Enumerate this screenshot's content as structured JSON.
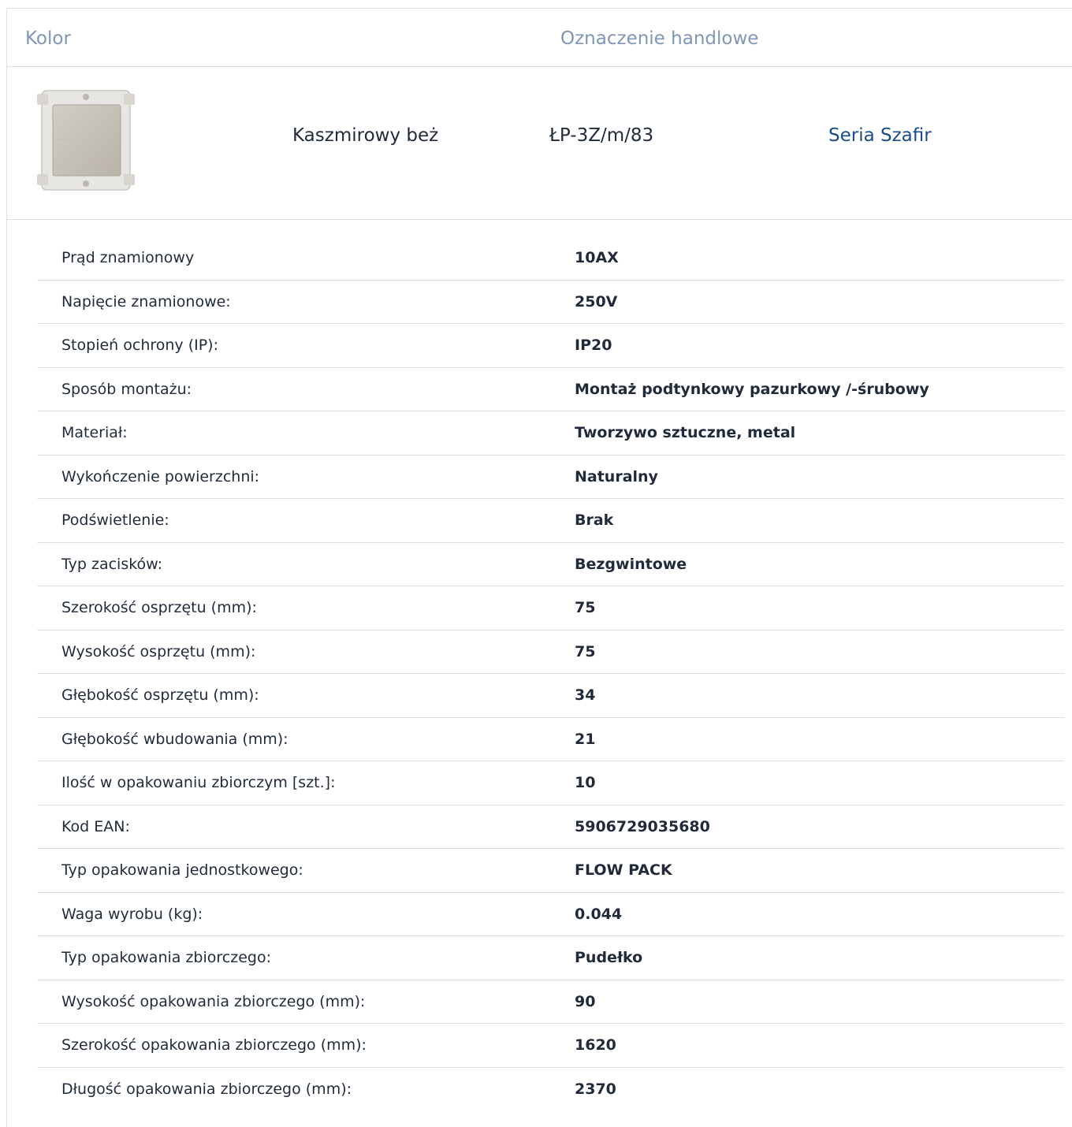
{
  "header": {
    "color_label": "Kolor",
    "designation_label": "Oznaczenie handlowe"
  },
  "product": {
    "image_icon": "light-switch-icon",
    "color_name": "Kaszmirowy beż",
    "designation": "ŁP-3Z/m/83",
    "series_link": "Seria Szafir",
    "colors": {
      "link": "#1a4c8c",
      "header_text": "#7f96b6",
      "body_text": "#1f2b3a",
      "divider": "#dcdfe3",
      "switch_face": "#c9c4bb"
    }
  },
  "specs": [
    {
      "label": "Prąd znamionowy",
      "value": "10AX"
    },
    {
      "label": "Napięcie znamionowe:",
      "value": "250V"
    },
    {
      "label": "Stopień ochrony (IP):",
      "value": "IP20"
    },
    {
      "label": "Sposób montażu:",
      "value": "Montaż podtynkowy pazurkowy /-śrubowy"
    },
    {
      "label": "Materiał:",
      "value": "Tworzywo sztuczne, metal"
    },
    {
      "label": "Wykończenie powierzchni:",
      "value": "Naturalny"
    },
    {
      "label": "Podświetlenie:",
      "value": "Brak"
    },
    {
      "label": "Typ zacisków:",
      "value": "Bezgwintowe"
    },
    {
      "label": "Szerokość osprzętu (mm):",
      "value": "75"
    },
    {
      "label": "Wysokość osprzętu (mm):",
      "value": "75"
    },
    {
      "label": "Głębokość osprzętu (mm):",
      "value": "34"
    },
    {
      "label": "Głębokość wbudowania (mm):",
      "value": "21"
    },
    {
      "label": "Ilość w opakowaniu zbiorczym [szt.]:",
      "value": "10"
    },
    {
      "label": "Kod EAN:",
      "value": "5906729035680"
    },
    {
      "label": "Typ opakowania jednostkowego:",
      "value": "FLOW PACK"
    },
    {
      "label": "Waga wyrobu (kg):",
      "value": "0.044"
    },
    {
      "label": "Typ opakowania zbiorczego:",
      "value": "Pudełko"
    },
    {
      "label": "Wysokość opakowania zbiorczego (mm):",
      "value": "90"
    },
    {
      "label": "Szerokość opakowania zbiorczego (mm):",
      "value": "1620"
    },
    {
      "label": "Długość opakowania zbiorczego (mm):",
      "value": "2370"
    }
  ]
}
